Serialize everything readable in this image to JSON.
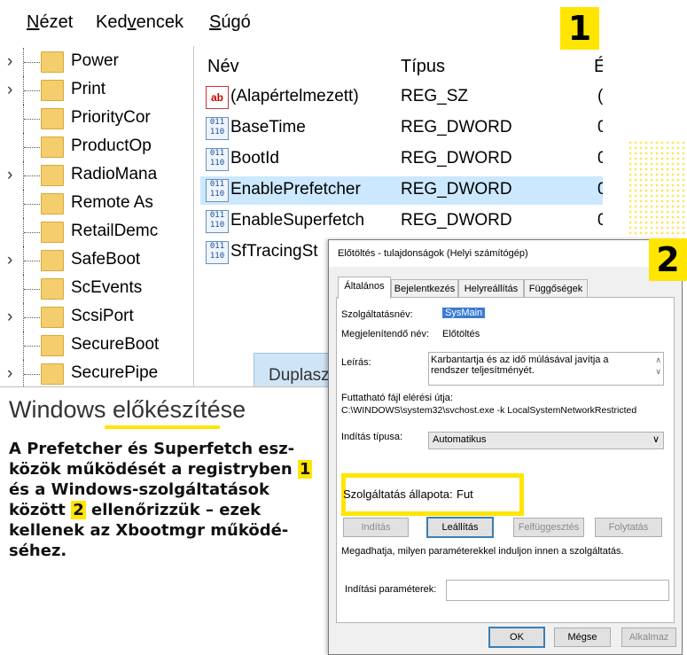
{
  "regedit": {
    "menu": [
      "Nézet",
      "Kedvencek",
      "Súgó"
    ],
    "menu_accel": [
      "N",
      "v",
      "S"
    ],
    "tree_items": [
      {
        "label": "Power",
        "expandable": true
      },
      {
        "label": "Print",
        "expandable": true
      },
      {
        "label": "PriorityCor",
        "expandable": false
      },
      {
        "label": "ProductOp",
        "expandable": false
      },
      {
        "label": "RadioMana",
        "expandable": true
      },
      {
        "label": "Remote As",
        "expandable": false
      },
      {
        "label": "RetailDemc",
        "expandable": false
      },
      {
        "label": "SafeBoot",
        "expandable": true
      },
      {
        "label": "ScEvents",
        "expandable": false
      },
      {
        "label": "ScsiPort",
        "expandable": true
      },
      {
        "label": "SecureBoot",
        "expandable": false
      },
      {
        "label": "SecurePipe",
        "expandable": true
      }
    ],
    "columns": [
      "Név",
      "Típus",
      "É"
    ],
    "values": [
      {
        "name": "(Alapértelmezett)",
        "type": "REG_SZ",
        "data": "(",
        "icon": "string-value-icon",
        "selected": false
      },
      {
        "name": "BaseTime",
        "type": "REG_DWORD",
        "data": "0",
        "icon": "dword-value-icon",
        "selected": false
      },
      {
        "name": "BootId",
        "type": "REG_DWORD",
        "data": "0",
        "icon": "dword-value-icon",
        "selected": false
      },
      {
        "name": "EnablePrefetcher",
        "type": "REG_DWORD",
        "data": "0",
        "icon": "dword-value-icon",
        "selected": true
      },
      {
        "name": "EnableSuperfetch",
        "type": "REG_DWORD",
        "data": "0",
        "icon": "dword-value-icon",
        "selected": false
      },
      {
        "name": "SfTracingSt",
        "type": "",
        "data": "",
        "icon": "dword-value-icon",
        "selected": false
      }
    ],
    "popup_text": "Duplaszo"
  },
  "badges": {
    "one": "1",
    "two": "2"
  },
  "caption": {
    "title": "Windows előkészítése",
    "body_1": "A Prefetcher és Superfetch esz-közök működését a registryben",
    "badge_1": "1",
    "body_2": "és a Windows-szolgáltatások között",
    "badge_2": "2",
    "body_3": "ellenőrizzük – ezek kellenek az Xbootmgr működé-séhez."
  },
  "dialog": {
    "title": "Előtöltés - tulajdonságok (Helyi számítógép)",
    "tabs": [
      "Általános",
      "Bejelentkezés",
      "Helyreállítás",
      "Függőségek"
    ],
    "active_tab": "Általános",
    "service_name_label": "Szolgáltatásnév:",
    "service_name": "SysMain",
    "display_name_label": "Megjelenítendő név:",
    "display_name": "Előtöltés",
    "description_label": "Leírás:",
    "description": "Karbantartja és az idő múlásával javítja a rendszer teljesítményét.",
    "path_label": "Futtatható fájl elérési útja:",
    "path": "C:\\WINDOWS\\system32\\svchost.exe -k LocalSystemNetworkRestricted",
    "startup_label": "Indítás típusa:",
    "startup_value": "Automatikus",
    "status_label": "Szolgáltatás állapota:",
    "status_value": "Fut",
    "buttons": {
      "start": "Indítás",
      "stop": "Leállítás",
      "pause": "Felfüggesztés",
      "resume": "Folytatás"
    },
    "params_hint": "Megadhatja, milyen paraméterekkel induljon innen a szolgáltatás.",
    "params_label": "Indítási paraméterek:",
    "params_value": "",
    "footer": {
      "ok": "OK",
      "cancel": "Mégse",
      "apply": "Alkalmaz"
    }
  },
  "colors": {
    "highlight": "#ffe500",
    "selection": "#cce8ff",
    "folder": "#f4cd6c"
  }
}
